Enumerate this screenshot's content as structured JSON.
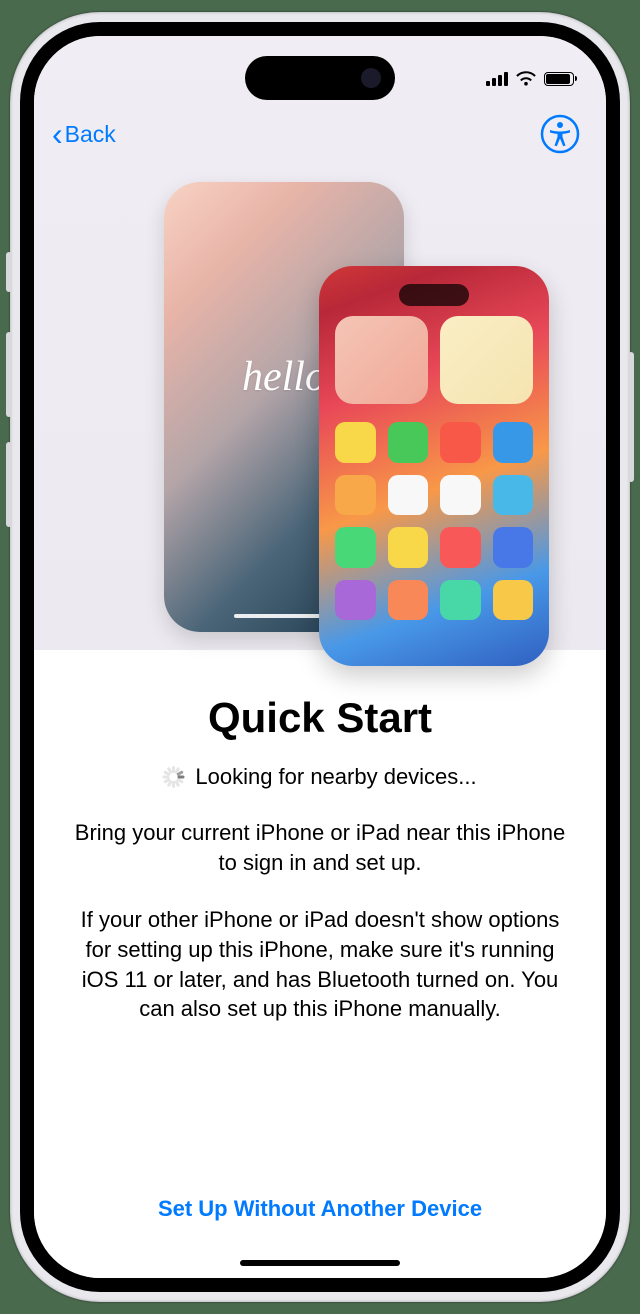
{
  "nav": {
    "back_label": "Back"
  },
  "hero": {
    "hello_text": "hello",
    "app_colors": [
      "#f8d848",
      "#48c858",
      "#f85848",
      "#3898e8",
      "#f8a848",
      "#f8f8f8",
      "#f8f8f8",
      "#48b8e8",
      "#48d878",
      "#f8d848",
      "#f85858",
      "#4878e8",
      "#a868d8",
      "#f88858",
      "#48d8a8",
      "#f8c848"
    ]
  },
  "content": {
    "title": "Quick Start",
    "looking_text": "Looking for nearby devices...",
    "paragraph1": "Bring your current iPhone or iPad near this iPhone to sign in and set up.",
    "paragraph2": "If your other iPhone or iPad doesn't show options for setting up this iPhone, make sure it's running iOS 11 or later, and has Bluetooth turned on. You can also set up this iPhone manually."
  },
  "footer": {
    "link_label": "Set Up Without Another Device"
  }
}
